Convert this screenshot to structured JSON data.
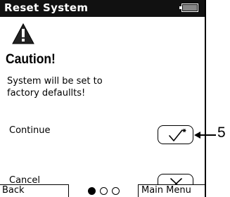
{
  "header": {
    "title": "Reset System",
    "battery_icon": "battery-icon"
  },
  "alert": {
    "icon": "warning-triangle-icon",
    "heading": "Caution!",
    "message_line1": "System will be set to",
    "message_line2": "factory defaullts!"
  },
  "options": {
    "continue_label": "Continue",
    "continue_icon": "checkmark-icon",
    "cancel_label": "Cancel",
    "cancel_icon": "x-icon"
  },
  "callout": {
    "number": "5"
  },
  "footer": {
    "left_softkey": "Back",
    "right_softkey": "Main Menu",
    "page_indicator": {
      "current": 1,
      "total": 3
    }
  },
  "colors": {
    "titlebar": "#111111",
    "text": "#000000",
    "background": "#ffffff"
  }
}
